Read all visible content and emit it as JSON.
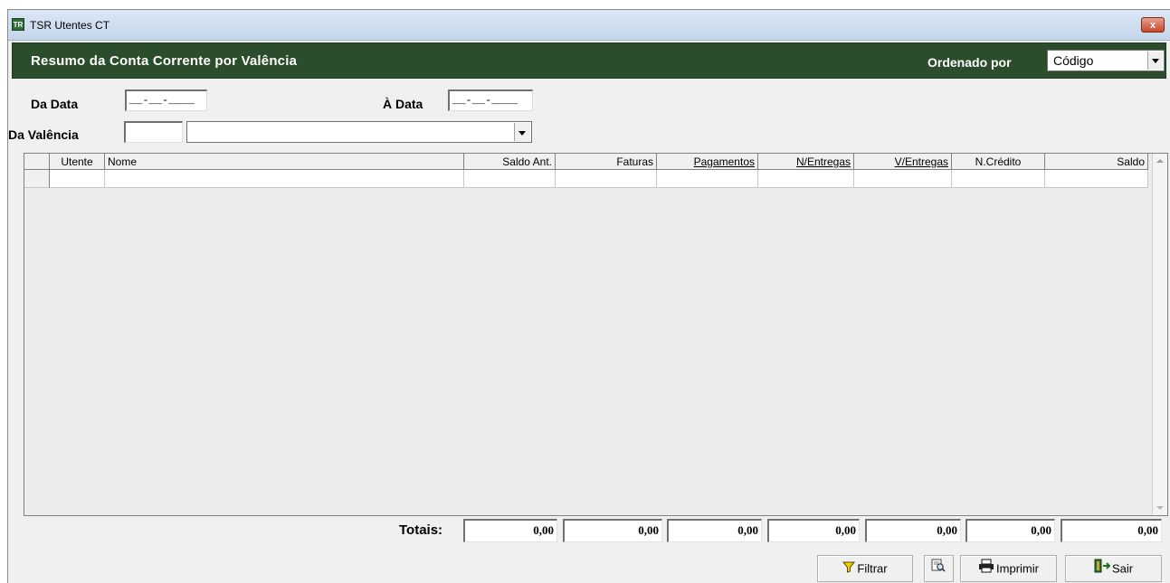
{
  "window": {
    "title": "TSR Utentes CT",
    "app_icon_text": "TR",
    "close_glyph": "x"
  },
  "header": {
    "title": "Resumo da Conta Corrente por Valência",
    "order_label": "Ordenado por",
    "order_value": "Código"
  },
  "filters": {
    "from_date_label": "Da Data",
    "from_date_value": "__-__-____",
    "to_date_label": "À Data",
    "to_date_value": "__-__-____",
    "valencia_label": "Da Valência",
    "valencia_code": "",
    "valencia_name": ""
  },
  "grid": {
    "columns": [
      "",
      "Utente",
      "Nome",
      "Saldo Ant.",
      "Faturas",
      "Pagamentos",
      "N/Entregas",
      "V/Entregas",
      "N.Crédito",
      "Saldo"
    ]
  },
  "totals": {
    "label": "Totais:",
    "values": [
      "0,00",
      "0,00",
      "0,00",
      "0,00",
      "0,00",
      "0,00",
      "0,00"
    ]
  },
  "buttons": {
    "filter": "Filtrar",
    "preview": "",
    "print": "Imprimir",
    "exit": "Sair"
  },
  "colors": {
    "header_bg": "#2b4d2c",
    "window_bg": "#f0f0f0",
    "title_bar": "#c4d6ea"
  },
  "icons": {
    "filter": "funnel-icon",
    "preview": "print-preview-icon",
    "print": "printer-icon",
    "exit": "exit-door-icon"
  }
}
